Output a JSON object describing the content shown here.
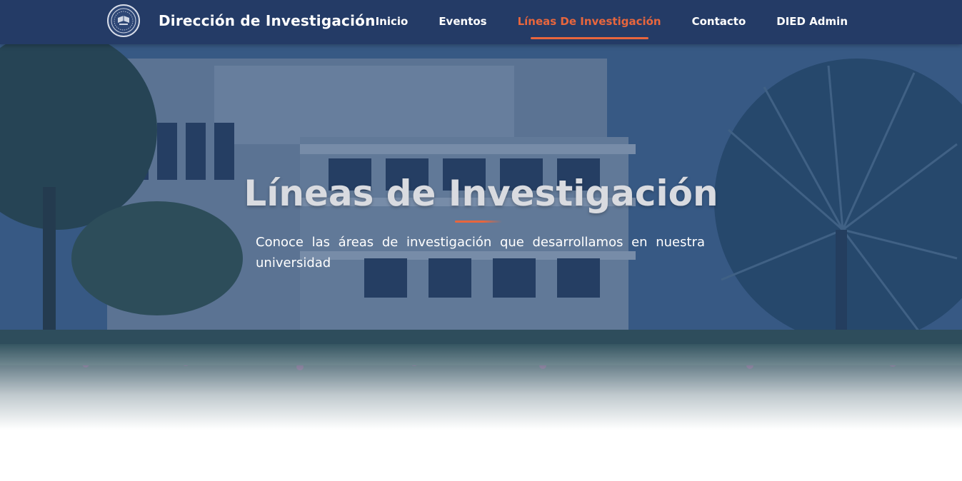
{
  "brand": {
    "title": "Dirección de Investigación",
    "logo_icon": "university-seal-icon"
  },
  "nav": {
    "items": [
      {
        "label": "Inicio",
        "active": false
      },
      {
        "label": "Eventos",
        "active": false
      },
      {
        "label": "Líneas De Investigación",
        "active": true
      },
      {
        "label": "Contacto",
        "active": false
      },
      {
        "label": "DIED Admin",
        "active": false
      }
    ]
  },
  "hero": {
    "title": "Líneas de Investigación",
    "subtitle": "Conoce las áreas de investigación que desarrollamos en nuestra universidad",
    "background": "campus-building-photo"
  },
  "colors": {
    "navbar": "#243b66",
    "accent": "#e8663d",
    "hero_overlay": "#1c3e70",
    "title_text": "#d9dbe0"
  }
}
